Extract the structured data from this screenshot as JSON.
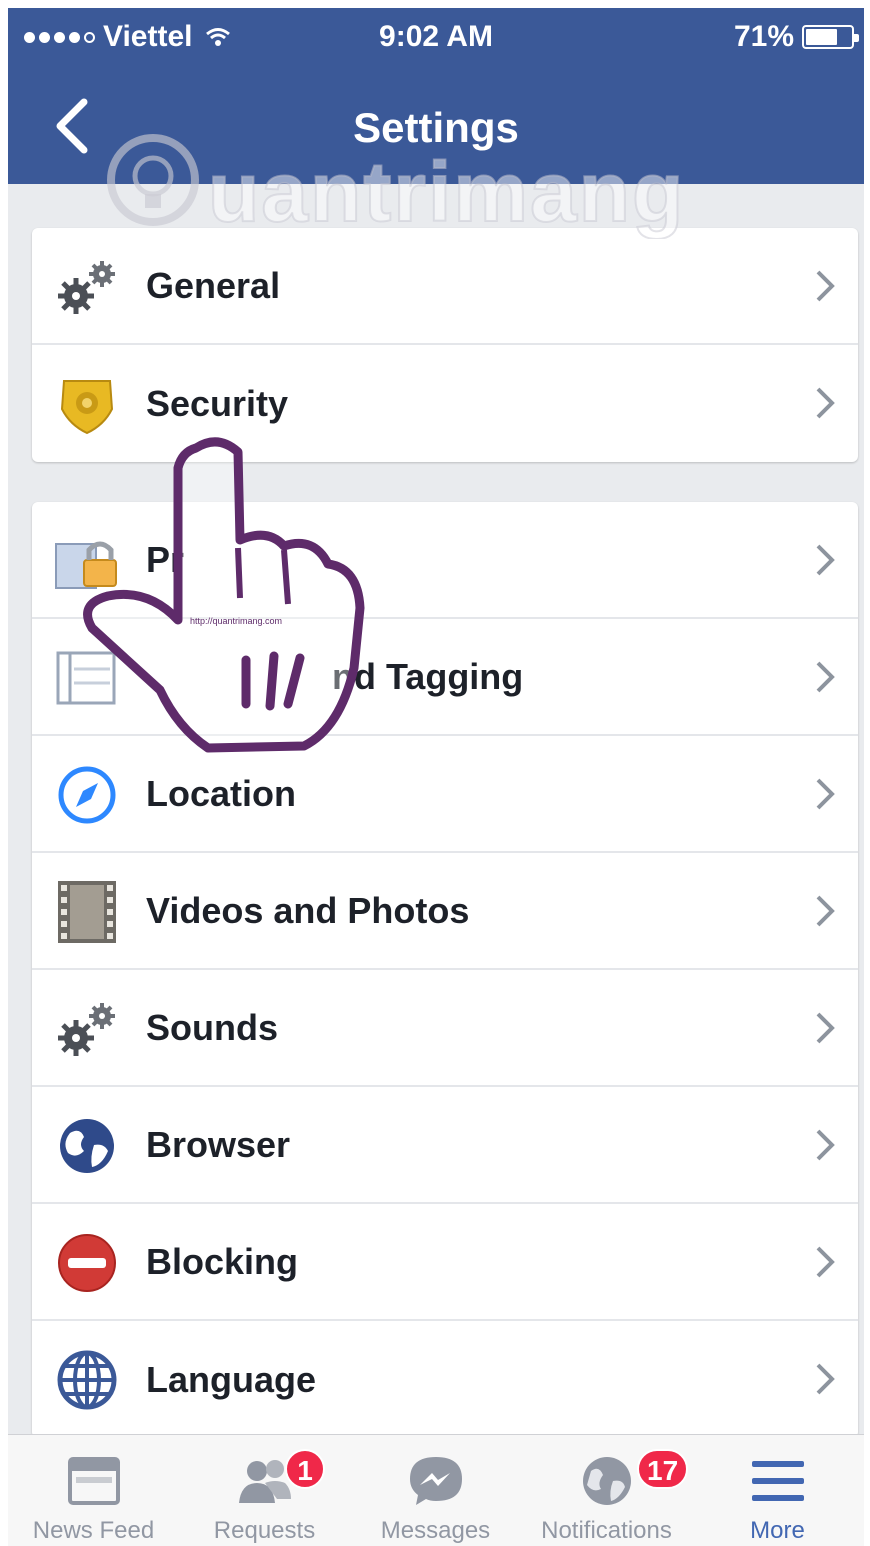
{
  "status_bar": {
    "carrier": "Viettel",
    "time": "9:02 AM",
    "battery_percent": "71%",
    "battery_level": 0.71
  },
  "nav": {
    "title": "Settings"
  },
  "group1": [
    {
      "label": "General",
      "icon": "gears-icon"
    },
    {
      "label": "Security",
      "icon": "shield-badge-icon"
    }
  ],
  "group2": [
    {
      "label": "Pr",
      "icon": "lock-doc-icon"
    },
    {
      "label": "nd Tagging",
      "icon": "timeline-icon"
    },
    {
      "label": "Location",
      "icon": "compass-icon"
    },
    {
      "label": "Videos and Photos",
      "icon": "film-icon"
    },
    {
      "label": "Sounds",
      "icon": "gears-icon"
    },
    {
      "label": "Browser",
      "icon": "globe-icon"
    },
    {
      "label": "Blocking",
      "icon": "no-entry-icon"
    },
    {
      "label": "Language",
      "icon": "language-globe-icon"
    }
  ],
  "tabbar": [
    {
      "label": "News Feed",
      "icon": "news-feed-icon"
    },
    {
      "label": "Requests",
      "icon": "friends-icon",
      "badge": "1"
    },
    {
      "label": "Messages",
      "icon": "messenger-icon"
    },
    {
      "label": "Notifications",
      "icon": "globe-icon",
      "badge": "17"
    },
    {
      "label": "More",
      "icon": "menu-icon",
      "active": true
    }
  ],
  "watermark": {
    "text": "uantrimang",
    "url_text": "http://quantrimang.com"
  },
  "colors": {
    "brand": "#3b5998",
    "active_tab": "#4267b2",
    "badge": "#f02849"
  }
}
